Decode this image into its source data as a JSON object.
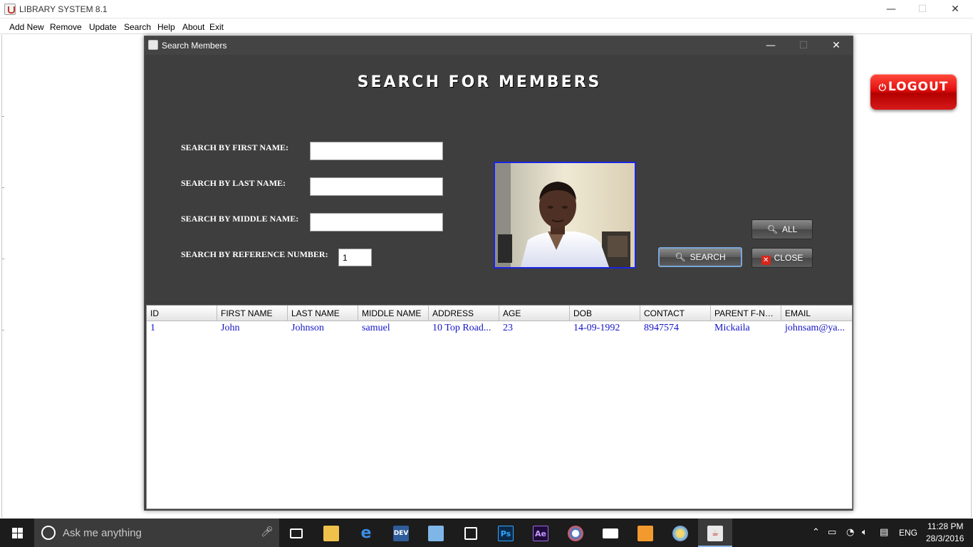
{
  "main_window": {
    "title": "LIBRARY SYSTEM 8.1",
    "controls": {
      "minimize": "—",
      "maximize": "☐",
      "close": "✕"
    }
  },
  "menubar": [
    "Add New",
    "Remove",
    "Update",
    "Search",
    "Help",
    "About",
    "Exit"
  ],
  "logout_button": "LOGOUT",
  "dialog": {
    "title": "Search Members",
    "controls": {
      "minimize": "—",
      "maximize": "☐",
      "close": "✕"
    },
    "heading": "SEARCH FOR MEMBERS",
    "labels": {
      "first_name": "SEARCH BY FIRST NAME:",
      "last_name": "SEARCH BY LAST NAME:",
      "middle_name": "SEARCH BY MIDDLE NAME:",
      "reference": "SEARCH BY REFERENCE NUMBER:"
    },
    "inputs": {
      "first_name": "",
      "last_name": "",
      "middle_name": "",
      "reference": "1"
    },
    "buttons": {
      "all": "ALL",
      "search": "SEARCH",
      "close": "CLOSE"
    },
    "table": {
      "columns": [
        "ID",
        "FIRST NAME",
        "LAST NAME",
        "MIDDLE NAME",
        "ADDRESS",
        "AGE",
        "DOB",
        "CONTACT",
        "PARENT F-NA...",
        "EMAIL"
      ],
      "rows": [
        [
          "1",
          "John",
          "Johnson",
          "samuel",
          "10 Top Road...",
          "23",
          "14-09-1992",
          "8947574",
          "Mickaila",
          "johnsam@ya..."
        ]
      ]
    }
  },
  "taskbar": {
    "search_placeholder": "Ask me anything",
    "apps": [
      "task-view",
      "file-explorer",
      "edge",
      "dev-cpp",
      "3d-box",
      "store",
      "photoshop",
      "after-effects",
      "browser",
      "mail",
      "media-player",
      "paint",
      "java"
    ],
    "language": "ENG",
    "time": "11:28 PM",
    "date": "28/3/2016"
  },
  "colors": {
    "dialog_bg": "#3e3e3e",
    "logout_red": "#e30f0f",
    "table_text": "#1515c8",
    "photo_border": "#1a24e6",
    "taskbar_bg": "#1c1c1c"
  }
}
